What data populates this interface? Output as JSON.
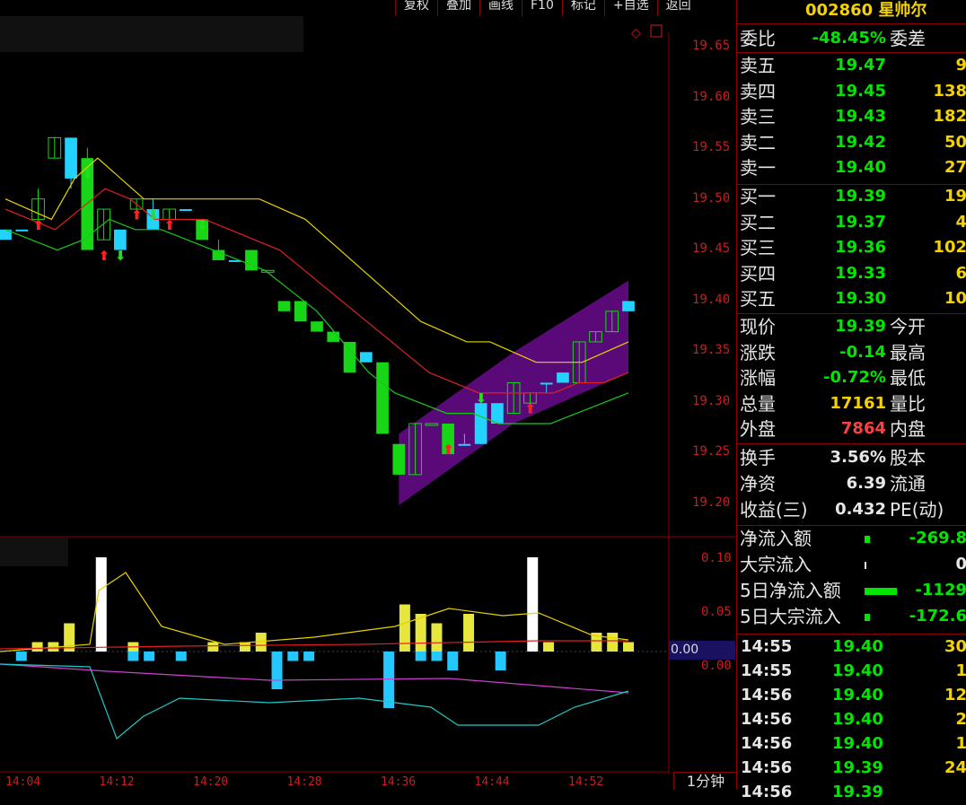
{
  "toolbar": {
    "buttons": [
      "复权",
      "叠加",
      "画线",
      "F10",
      "标记",
      "+自选",
      "返回"
    ]
  },
  "stock": {
    "code": "002860",
    "name": "星帅尔"
  },
  "price_axis": {
    "ticks": [
      "19.65",
      "19.60",
      "19.55",
      "19.50",
      "19.45",
      "19.40",
      "19.35",
      "19.30",
      "19.25",
      "19.20"
    ]
  },
  "indicator_axis": {
    "ticks": [
      "0.10",
      "0.05",
      "0.00"
    ],
    "current": "0.00"
  },
  "time_axis": {
    "ticks": [
      "14:04",
      "14:12",
      "14:20",
      "14:28",
      "14:36",
      "14:44",
      "14:52"
    ]
  },
  "period_label": "1分钟",
  "quote": {
    "webi": {
      "label": "委比",
      "value": "-48.45%",
      "label2": "委差"
    },
    "asks": [
      {
        "label": "卖五",
        "price": "19.47",
        "vol": "9"
      },
      {
        "label": "卖四",
        "price": "19.45",
        "vol": "138"
      },
      {
        "label": "卖三",
        "price": "19.43",
        "vol": "182"
      },
      {
        "label": "卖二",
        "price": "19.42",
        "vol": "50"
      },
      {
        "label": "卖一",
        "price": "19.40",
        "vol": "27"
      }
    ],
    "bids": [
      {
        "label": "买一",
        "price": "19.39",
        "vol": "19"
      },
      {
        "label": "买二",
        "price": "19.37",
        "vol": "4"
      },
      {
        "label": "买三",
        "price": "19.36",
        "vol": "102"
      },
      {
        "label": "买四",
        "price": "19.33",
        "vol": "6"
      },
      {
        "label": "买五",
        "price": "19.30",
        "vol": "10"
      }
    ],
    "stats1": [
      {
        "label": "现价",
        "value": "19.39",
        "label2": "今开",
        "color": "#00e600"
      },
      {
        "label": "涨跌",
        "value": "-0.14",
        "label2": "最高",
        "color": "#00e600"
      },
      {
        "label": "涨幅",
        "value": "-0.72%",
        "label2": "最低",
        "color": "#00e600"
      },
      {
        "label": "总量",
        "value": "17161",
        "label2": "量比",
        "color": "#f5d200"
      },
      {
        "label": "外盘",
        "value": "7864",
        "label2": "内盘",
        "color": "#ff4040"
      }
    ],
    "stats2": [
      {
        "label": "换手",
        "value": "3.56%",
        "label2": "股本"
      },
      {
        "label": "净资",
        "value": "6.39",
        "label2": "流通"
      },
      {
        "label": "收益(三)",
        "value": "0.432",
        "label2": "PE(动)"
      }
    ],
    "flows": [
      {
        "label": "净流入额",
        "value": "-269.8"
      },
      {
        "label": "大宗流入",
        "value": "0"
      },
      {
        "label": "5日净流入额",
        "value": "-1129"
      },
      {
        "label": "5日大宗流入",
        "value": "-172.6"
      }
    ],
    "ticks": [
      {
        "time": "14:55",
        "price": "19.40",
        "vol": "30"
      },
      {
        "time": "14:55",
        "price": "19.40",
        "vol": "1"
      },
      {
        "time": "14:56",
        "price": "19.40",
        "vol": "12"
      },
      {
        "time": "14:56",
        "price": "19.40",
        "vol": "2"
      },
      {
        "time": "14:56",
        "price": "19.40",
        "vol": "1"
      },
      {
        "time": "14:56",
        "price": "19.39",
        "vol": "24"
      },
      {
        "time": "14:56",
        "price": "19.39",
        "vol": ""
      }
    ]
  },
  "chart_data": {
    "type": "candlestick",
    "interval": "1分钟",
    "ylim": [
      19.2,
      19.65
    ],
    "candles": [
      {
        "t": "14:00",
        "o": 19.47,
        "c": 19.46,
        "h": 19.47,
        "l": 19.46,
        "col": "cyan"
      },
      {
        "t": "14:02",
        "o": 19.47,
        "c": 19.47,
        "h": 19.47,
        "l": 19.47,
        "col": "cyan"
      },
      {
        "t": "14:04",
        "o": 19.48,
        "c": 19.5,
        "h": 19.51,
        "l": 19.48,
        "col": "green"
      },
      {
        "t": "14:06",
        "o": 19.54,
        "c": 19.56,
        "h": 19.56,
        "l": 19.54,
        "col": "green"
      },
      {
        "t": "14:08",
        "o": 19.56,
        "c": 19.52,
        "h": 19.56,
        "l": 19.51,
        "col": "cyan"
      },
      {
        "t": "14:10",
        "o": 19.54,
        "c": 19.45,
        "h": 19.55,
        "l": 19.45,
        "col": "green"
      },
      {
        "t": "14:12",
        "o": 19.46,
        "c": 19.49,
        "h": 19.49,
        "l": 19.46,
        "col": "green"
      },
      {
        "t": "14:14",
        "o": 19.47,
        "c": 19.45,
        "h": 19.47,
        "l": 19.45,
        "col": "cyan"
      },
      {
        "t": "14:16",
        "o": 19.49,
        "c": 19.5,
        "h": 19.5,
        "l": 19.49,
        "col": "green"
      },
      {
        "t": "14:18",
        "o": 19.49,
        "c": 19.47,
        "h": 19.5,
        "l": 19.47,
        "col": "cyan"
      },
      {
        "t": "14:20",
        "o": 19.48,
        "c": 19.49,
        "h": 19.49,
        "l": 19.48,
        "col": "green"
      },
      {
        "t": "14:22",
        "o": 19.49,
        "c": 19.49,
        "h": 19.49,
        "l": 19.49,
        "col": "cyan"
      },
      {
        "t": "14:24",
        "o": 19.48,
        "c": 19.46,
        "h": 19.48,
        "l": 19.46,
        "col": "green"
      },
      {
        "t": "14:26",
        "o": 19.45,
        "c": 19.44,
        "h": 19.46,
        "l": 19.44,
        "col": "green"
      },
      {
        "t": "14:28",
        "o": 19.44,
        "c": 19.44,
        "h": 19.44,
        "l": 19.44,
        "col": "cyan"
      },
      {
        "t": "14:30",
        "o": 19.45,
        "c": 19.43,
        "h": 19.45,
        "l": 19.43,
        "col": "green"
      },
      {
        "t": "14:32",
        "o": 19.43,
        "c": 19.43,
        "h": 19.43,
        "l": 19.43,
        "col": "green"
      },
      {
        "t": "14:34",
        "o": 19.4,
        "c": 19.39,
        "h": 19.4,
        "l": 19.39,
        "col": "green"
      },
      {
        "t": "14:35",
        "o": 19.4,
        "c": 19.38,
        "h": 19.4,
        "l": 19.38,
        "col": "green"
      },
      {
        "t": "14:36",
        "o": 19.38,
        "c": 19.37,
        "h": 19.38,
        "l": 19.37,
        "col": "green"
      },
      {
        "t": "14:37",
        "o": 19.37,
        "c": 19.36,
        "h": 19.37,
        "l": 19.36,
        "col": "green"
      },
      {
        "t": "14:38",
        "o": 19.36,
        "c": 19.33,
        "h": 19.36,
        "l": 19.33,
        "col": "green"
      },
      {
        "t": "14:39",
        "o": 19.35,
        "c": 19.34,
        "h": 19.35,
        "l": 19.34,
        "col": "cyan"
      },
      {
        "t": "14:40",
        "o": 19.34,
        "c": 19.27,
        "h": 19.34,
        "l": 19.27,
        "col": "green"
      },
      {
        "t": "14:41",
        "o": 19.26,
        "c": 19.23,
        "h": 19.26,
        "l": 19.23,
        "col": "green"
      },
      {
        "t": "14:42",
        "o": 19.23,
        "c": 19.28,
        "h": 19.28,
        "l": 19.23,
        "col": "green"
      },
      {
        "t": "14:43",
        "o": 19.28,
        "c": 19.28,
        "h": 19.28,
        "l": 19.28,
        "col": "green"
      },
      {
        "t": "14:44",
        "o": 19.28,
        "c": 19.25,
        "h": 19.28,
        "l": 19.25,
        "col": "green"
      },
      {
        "t": "14:45",
        "o": 19.26,
        "c": 19.26,
        "h": 19.27,
        "l": 19.26,
        "col": "cyan"
      },
      {
        "t": "14:46",
        "o": 19.3,
        "c": 19.26,
        "h": 19.3,
        "l": 19.26,
        "col": "cyan"
      },
      {
        "t": "14:47",
        "o": 19.28,
        "c": 19.3,
        "h": 19.3,
        "l": 19.28,
        "col": "cyan"
      },
      {
        "t": "14:48",
        "o": 19.29,
        "c": 19.32,
        "h": 19.32,
        "l": 19.29,
        "col": "green"
      },
      {
        "t": "14:49",
        "o": 19.3,
        "c": 19.31,
        "h": 19.31,
        "l": 19.3,
        "col": "green"
      },
      {
        "t": "14:50",
        "o": 19.32,
        "c": 19.32,
        "h": 19.32,
        "l": 19.31,
        "col": "cyan"
      },
      {
        "t": "14:51",
        "o": 19.33,
        "c": 19.32,
        "h": 19.33,
        "l": 19.32,
        "col": "cyan"
      },
      {
        "t": "14:52",
        "o": 19.32,
        "c": 19.36,
        "h": 19.36,
        "l": 19.32,
        "col": "green"
      },
      {
        "t": "14:53",
        "o": 19.36,
        "c": 19.37,
        "h": 19.37,
        "l": 19.36,
        "col": "green"
      },
      {
        "t": "14:54",
        "o": 19.37,
        "c": 19.39,
        "h": 19.39,
        "l": 19.37,
        "col": "green"
      },
      {
        "t": "14:55",
        "o": 19.4,
        "c": 19.39,
        "h": 19.4,
        "l": 19.39,
        "col": "cyan"
      }
    ],
    "ma_yellow": [
      19.5,
      19.49,
      19.48,
      19.52,
      19.54,
      19.52,
      19.5,
      19.5,
      19.5,
      19.5,
      19.5,
      19.5,
      19.49,
      19.48,
      19.46,
      19.44,
      19.42,
      19.4,
      19.38,
      19.37,
      19.36,
      19.36,
      19.35,
      19.34,
      19.34,
      19.34,
      19.35,
      19.36
    ],
    "ma_red": [
      19.49,
      19.48,
      19.47,
      19.49,
      19.51,
      19.5,
      19.48,
      19.48,
      19.48,
      19.47,
      19.46,
      19.45,
      19.43,
      19.41,
      19.39,
      19.37,
      19.35,
      19.33,
      19.32,
      19.31,
      19.31,
      19.31,
      19.31,
      19.32,
      19.32,
      19.33
    ],
    "ma_green": [
      19.47,
      19.46,
      19.45,
      19.46,
      19.48,
      19.47,
      19.47,
      19.46,
      19.45,
      19.44,
      19.43,
      19.41,
      19.39,
      19.36,
      19.33,
      19.31,
      19.3,
      19.29,
      19.29,
      19.28,
      19.28,
      19.28,
      19.29,
      19.3,
      19.31
    ],
    "indicator": {
      "ylim": [
        -0.05,
        0.11
      ],
      "bars": [
        0.0,
        0.0,
        0.01,
        0.01,
        0.03,
        0.0,
        0.1,
        0.0,
        0.01,
        0.0,
        0.0,
        0.0,
        0.0,
        0.01,
        0.0,
        0.01,
        0.02,
        0.0,
        0.0,
        0.0,
        0.0,
        0.0,
        0.0,
        0.0,
        0.0,
        0.05,
        0.04,
        0.03,
        0.0,
        0.04,
        0.0,
        0.0,
        0.0,
        0.1,
        0.01,
        0.0,
        0.0,
        0.02,
        0.02,
        0.01
      ],
      "neg_bars": [
        0.0,
        -0.01,
        0.0,
        0.0,
        0.0,
        0.0,
        0.0,
        0.0,
        -0.01,
        -0.01,
        0.0,
        -0.01,
        0.0,
        0.0,
        0.0,
        0.0,
        0.0,
        -0.04,
        -0.01,
        -0.01,
        0.0,
        0.0,
        0.0,
        0.0,
        -0.06,
        0.0,
        -0.01,
        -0.01,
        -0.02,
        0.0,
        0.0,
        -0.02,
        0.0,
        0.0,
        0.0,
        0.0,
        0.0,
        0.0,
        0.0,
        0.0
      ]
    }
  }
}
